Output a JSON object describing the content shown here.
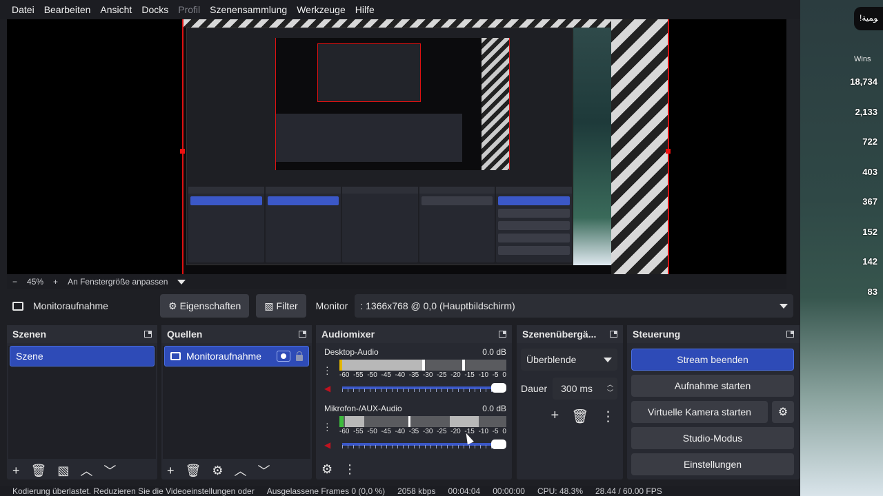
{
  "menu": [
    "Datei",
    "Bearbeiten",
    "Ansicht",
    "Docks",
    "Profil",
    "Szenensammlung",
    "Werkzeuge",
    "Hilfe"
  ],
  "zoom": {
    "minus": "−",
    "value": "45%",
    "plus": "+",
    "fit": "An Fenstergröße anpassen"
  },
  "source_toolbar": {
    "source_name": "Monitoraufnahme",
    "properties": "Eigenschaften",
    "filter": "Filter",
    "monitor_label": "Monitor",
    "monitor_value": ": 1366x768 @ 0,0 (Hauptbildschirm)"
  },
  "scenes": {
    "title": "Szenen",
    "items": [
      "Szene"
    ]
  },
  "sources": {
    "title": "Quellen",
    "items": [
      "Monitoraufnahme"
    ]
  },
  "mixer": {
    "title": "Audiomixer",
    "scale": [
      "-60",
      "-55",
      "-50",
      "-45",
      "-40",
      "-35",
      "-30",
      "-25",
      "-20",
      "-15",
      "-10",
      "-5",
      "0"
    ],
    "channels": [
      {
        "name": "Desktop-Audio",
        "db": "0.0 dB"
      },
      {
        "name": "Mikrofon-/AUX-Audio",
        "db": "0.0 dB"
      }
    ]
  },
  "transitions": {
    "title": "Szenenübergä...",
    "selected": "Überblende",
    "duration_label": "Dauer",
    "duration_value": "300 ms"
  },
  "controls": {
    "title": "Steuerung",
    "stream": "Stream beenden",
    "record": "Aufnahme starten",
    "virtual_cam": "Virtuelle Kamera starten",
    "studio": "Studio-Modus",
    "settings": "Einstellungen"
  },
  "game_overlay": {
    "chip": "!ﻮﻤﻴﺔ",
    "wins_title": "Wins",
    "wins": [
      "18,734",
      "2,133",
      "722",
      "403",
      "367",
      "152",
      "142",
      "83"
    ]
  },
  "statusbar": {
    "warning": "Kodierung überlastet. Reduzieren Sie die Videoeinstellungen oder",
    "dropped": "Ausgelassene Frames 0 (0,0 %)",
    "bitrate": "2058 kbps",
    "stream_time": "00:04:04",
    "rec_time": "00:00:00",
    "cpu": "CPU: 48.3%",
    "fps": "28.44 / 60.00 FPS"
  },
  "colors": {
    "accent": "#2e4bb7",
    "background": "#1e1f24",
    "dock": "#272931",
    "recording_border": "#dd1111"
  }
}
